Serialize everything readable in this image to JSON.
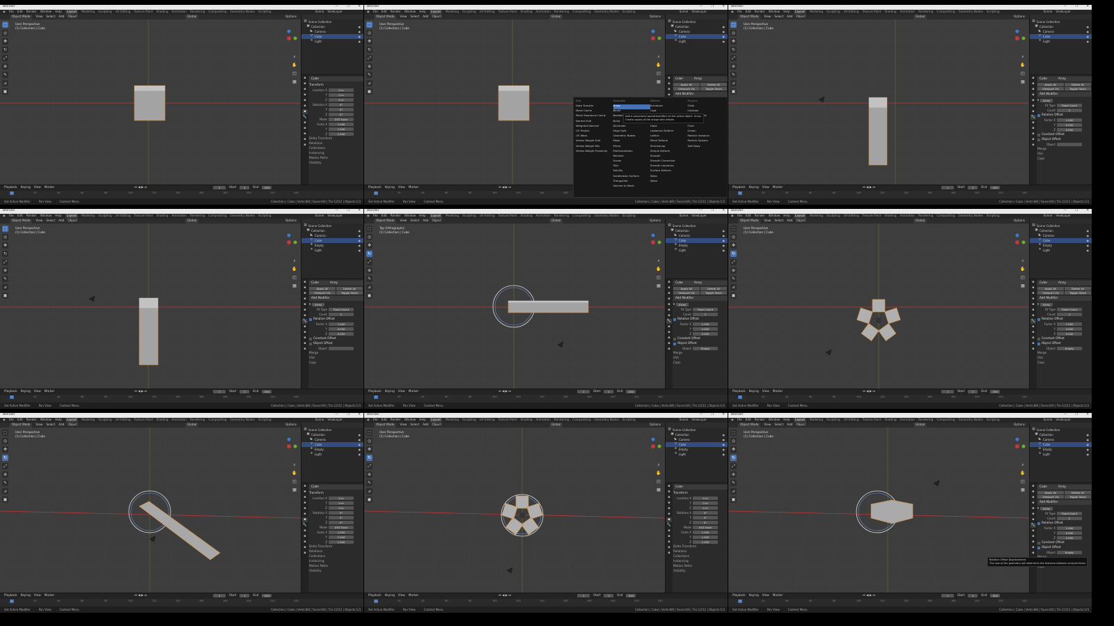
{
  "window_title": "Blender",
  "menus": [
    "File",
    "Edit",
    "Render",
    "Window",
    "Help"
  ],
  "workspaces": [
    "Layout",
    "Modeling",
    "Sculpting",
    "UV Editing",
    "Texture Paint",
    "Shading",
    "Animation",
    "Rendering",
    "Compositing",
    "Geometry Nodes",
    "Scripting"
  ],
  "scene": "Scene",
  "view_layer": "ViewLayer",
  "header": {
    "mode": "Object Mode",
    "items": [
      "View",
      "Select",
      "Add",
      "Object"
    ],
    "orientation": "Global",
    "options": "Options"
  },
  "timeline": {
    "items": [
      "Playback",
      "Keying",
      "View",
      "Marker"
    ],
    "frame": "1",
    "start_label": "Start",
    "start": "1",
    "end_label": "End",
    "end": "250",
    "ticks": [
      "0",
      "20",
      "40",
      "60",
      "80",
      "100",
      "120",
      "140",
      "160",
      "180",
      "200",
      "220",
      "240"
    ]
  },
  "object_props": {
    "name": "Cube",
    "sections": [
      "Transform"
    ],
    "rows": [
      [
        "Location X",
        "0 m"
      ],
      [
        "Y",
        "0 m"
      ],
      [
        "Z",
        "0 m"
      ],
      [
        "Rotation X",
        "0°"
      ],
      [
        "Y",
        "0°"
      ],
      [
        "Z",
        "0°"
      ],
      [
        "Mode",
        "XYZ Euler"
      ],
      [
        "Scale X",
        "1.000"
      ],
      [
        "Y",
        "1.000"
      ],
      [
        "Z",
        "1.000"
      ]
    ],
    "collapsed": [
      "Delta Transform",
      "Relations",
      "Collections",
      "Instancing",
      "Motion Paths",
      "Visibility"
    ]
  },
  "modifier": {
    "name": "Cube",
    "title": "Array",
    "buttons": [
      "Apply All",
      "Delete All",
      "Viewport Vis",
      "Toggle Stack"
    ],
    "add_label": "Add Modifier",
    "fit_label": "Fit Type",
    "fit": "Fixed Count",
    "count_label": "Count",
    "count": "2",
    "relative": "Relative Offset",
    "factor_rows": [
      [
        "Factor X",
        "1.000"
      ],
      [
        "Y",
        "0.000"
      ],
      [
        "Z",
        "0.000"
      ]
    ],
    "constant": "Constant Offset",
    "object_offset": "Object Offset",
    "object_label": "Object",
    "object_value": "Empty",
    "tail": [
      "Merge",
      "UVs",
      "Caps"
    ]
  },
  "add_menu": {
    "columns": [
      {
        "title": "Edit",
        "items": [
          "Data Transfer",
          "Mesh Cache",
          "Mesh Sequence Cache",
          "Normal Edit",
          "Weighted Normal",
          "UV Project",
          "UV Warp",
          "Vertex Weight Edit",
          "Vertex Weight Mix",
          "Vertex Weight Proximity"
        ]
      },
      {
        "title": "Generate",
        "items": [
          "Array",
          "Bevel",
          "Boolean",
          "Build",
          "Decimate",
          "Edge Split",
          "Geometry Nodes",
          "Mask",
          "Mirror",
          "Multiresolution",
          "Remesh",
          "Screw",
          "Skin",
          "Solidify",
          "Subdivision Surface",
          "Triangulate",
          "Volume to Mesh"
        ]
      },
      {
        "title": "Deform",
        "items": [
          "Armature",
          "Cast",
          "Curve",
          "Displace",
          "Hook",
          "Laplacian Deform",
          "Lattice",
          "Mesh Deform",
          "Shrinkwrap",
          "Simple Deform",
          "Smooth",
          "Smooth Corrective",
          "Smooth Laplacian",
          "Surface Deform",
          "Warp",
          "Wave"
        ]
      },
      {
        "title": "Physics",
        "items": [
          "Cloth",
          "Collision",
          "Dynamic Paint",
          "Explode",
          "Fluid",
          "Ocean",
          "Particle Instance",
          "Particle System",
          "Soft Body"
        ]
      }
    ],
    "tooltip": [
      "Add a procedural operation/effect to the active object.  Array:",
      "Create copies of the shape with offsets"
    ]
  },
  "offset_tooltip": [
    "Relative Offset Displacement",
    "The size of the geometry will determine the distance between arrayed items"
  ],
  "status": {
    "left": [
      "Set Active Modifier",
      "Pan View",
      "Context Menu"
    ],
    "right": "Collection | Cube | Verts:8/8 | Faces:6/6 | Tris:12/12 | Objects:1/3"
  },
  "panels": [
    {
      "view": "User Perspective",
      "collection": "(1) Collection | Cube",
      "outliner": [
        "Scene Collection",
        "Collection",
        "Camera",
        "Cube",
        "Light"
      ],
      "props": "object"
    },
    {
      "view": "User Perspective",
      "collection": "(1) Collection | Cube",
      "outliner": [
        "Scene Collection",
        "Collection",
        "Camera",
        "Cube",
        "Light"
      ],
      "props": "modifier"
    },
    {
      "view": "User Perspective",
      "collection": "(1) Collection | Cube",
      "outliner": [
        "Scene Collection",
        "Collection",
        "Camera",
        "Cube",
        "Light"
      ],
      "props": "modifier"
    },
    {
      "view": "User Perspective",
      "collection": "(1) Collection | Cube",
      "outliner": [
        "Scene Collection",
        "Collection",
        "Camera",
        "Cube",
        "Empty",
        "Light"
      ],
      "props": "modifier"
    },
    {
      "view": "Top Orthographic",
      "collection": "(1) Collection | Cube",
      "outliner": [
        "Scene Collection",
        "Collection",
        "Camera",
        "Cube",
        "Empty",
        "Light"
      ],
      "props": "modifier"
    },
    {
      "view": "User Perspective",
      "collection": "(1) Collection | Cube",
      "outliner": [
        "Scene Collection",
        "Collection",
        "Camera",
        "Cube",
        "Empty",
        "Light"
      ],
      "props": "modifier"
    },
    {
      "view": "User Perspective",
      "collection": "(1) Collection | Cube",
      "outliner": [
        "Scene Collection",
        "Collection",
        "Camera",
        "Cube",
        "Empty",
        "Light"
      ],
      "props": "object"
    },
    {
      "view": "User Perspective",
      "collection": "(1) Collection | Cube",
      "outliner": [
        "Scene Collection",
        "Collection",
        "Camera",
        "Cube",
        "Empty",
        "Light"
      ],
      "props": "object"
    },
    {
      "view": "User Perspective",
      "collection": "(1) Collection | Cube",
      "outliner": [
        "Scene Collection",
        "Collection",
        "Camera",
        "Cube",
        "Empty",
        "Light"
      ],
      "props": "modifier"
    }
  ],
  "colors": {
    "accent": "#4772b3",
    "selection": "#e08a28",
    "x_axis": "#c0393b",
    "y_axis": "#6f9a2a",
    "viewport": "#3d3d3d"
  }
}
